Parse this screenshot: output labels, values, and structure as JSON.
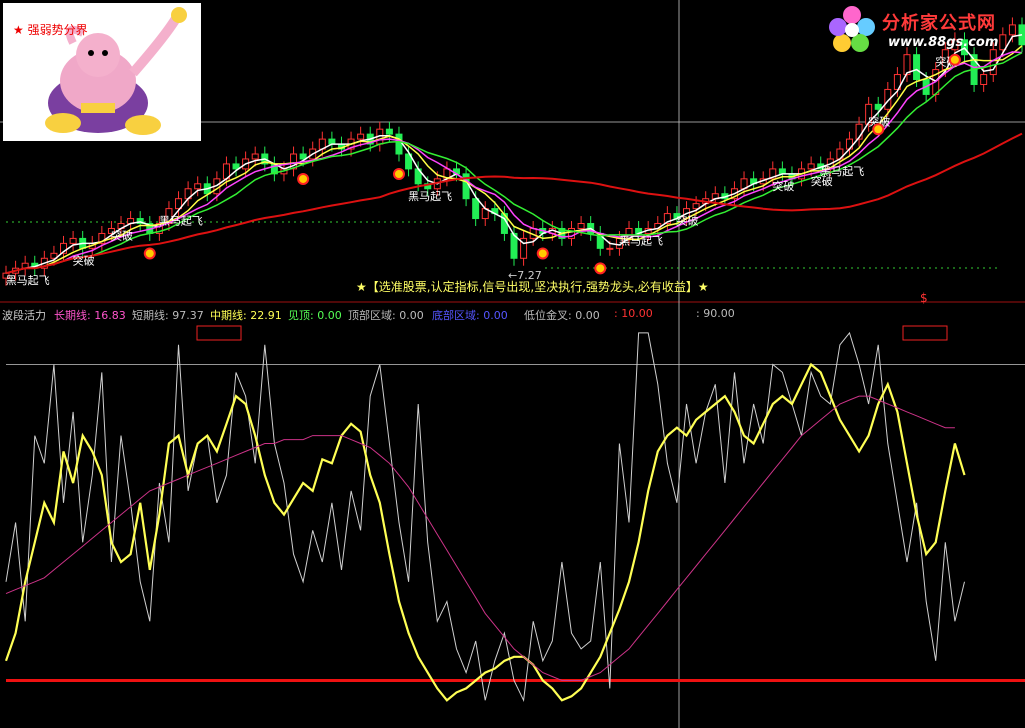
{
  "thumbnail": {
    "title": "★ 强弱势分界"
  },
  "brand": {
    "name": "分析家公式网",
    "url": "www.88gs.com"
  },
  "slogan": "★【选准股票,认定指标,信号出现,坚决执行,强势龙头,必有收益】★",
  "price_panel": {
    "low_marker": "←7.27",
    "dollar_marker": "$",
    "labels": [
      {
        "text": "黑马起飞",
        "i": 1
      },
      {
        "text": "突破",
        "i": 8
      },
      {
        "text": "突破",
        "i": 12
      },
      {
        "text": "黑马起飞",
        "i": 17
      },
      {
        "text": "黑马起飞",
        "i": 43
      },
      {
        "text": "黑马起飞",
        "i": 65
      },
      {
        "text": "突破",
        "i": 71
      },
      {
        "text": "突破",
        "i": 81
      },
      {
        "text": "突破",
        "i": 85
      },
      {
        "text": "黑马起飞",
        "i": 86
      },
      {
        "text": "突破",
        "i": 91
      },
      {
        "text": "突破",
        "i": 98
      }
    ],
    "buy_signals": [
      15,
      31,
      41,
      56,
      62,
      91,
      99
    ]
  },
  "indicator_legend": [
    {
      "key": "name",
      "text": "波段活力",
      "color": "#cccccc"
    },
    {
      "key": "long",
      "text": "长期线: 16.83",
      "color": "#ff55cc"
    },
    {
      "key": "short",
      "text": "短期线: 97.37",
      "color": "#bbbbbb"
    },
    {
      "key": "mid",
      "text": "中期线: 22.91",
      "color": "#ffff55"
    },
    {
      "key": "see",
      "text": "见顶: 0.00",
      "color": "#55ff55"
    },
    {
      "key": "top",
      "text": "顶部区域: 0.00",
      "color": "#bbbbbb"
    },
    {
      "key": "bottom",
      "text": "底部区域: 0.00",
      "color": "#5555ff"
    },
    {
      "key": "gold",
      "text": "低位金叉: 0.00",
      "color": "#bbbbbb"
    },
    {
      "key": "v10",
      "text": ": 10.00",
      "color": "#ff3333"
    },
    {
      "key": "v90",
      "text": ": 90.00",
      "color": "#bbbbbb"
    }
  ],
  "chart_data": [
    {
      "type": "candlestick",
      "close": [
        6.9,
        7.0,
        7.1,
        7.0,
        7.2,
        7.3,
        7.5,
        7.6,
        7.4,
        7.5,
        7.7,
        7.8,
        7.9,
        8.0,
        7.9,
        7.7,
        7.9,
        8.2,
        8.4,
        8.6,
        8.7,
        8.5,
        8.8,
        9.1,
        9.0,
        9.2,
        9.3,
        9.1,
        8.9,
        9.0,
        9.3,
        9.2,
        9.4,
        9.6,
        9.5,
        9.4,
        9.6,
        9.7,
        9.5,
        9.8,
        9.7,
        9.3,
        9.0,
        8.7,
        8.6,
        8.8,
        9.0,
        8.9,
        8.4,
        8.0,
        8.2,
        8.1,
        7.7,
        7.2,
        7.6,
        7.8,
        7.7,
        7.8,
        7.6,
        7.8,
        7.9,
        7.7,
        7.4,
        7.4,
        7.6,
        7.8,
        7.7,
        7.8,
        7.9,
        8.1,
        8.0,
        8.2,
        8.3,
        8.4,
        8.5,
        8.4,
        8.6,
        8.8,
        8.7,
        8.8,
        9.0,
        8.9,
        8.8,
        9.0,
        9.1,
        9.0,
        9.2,
        9.4,
        9.6,
        9.9,
        10.3,
        10.2,
        10.6,
        10.9,
        11.3,
        10.8,
        10.5,
        11.0,
        11.4,
        11.6,
        11.3,
        10.7,
        10.9,
        11.4,
        11.7,
        11.9,
        11.5
      ]
    },
    {
      "type": "line",
      "name_keys": [
        "short",
        "mid",
        "long"
      ],
      "ylim": [
        0,
        100
      ],
      "reference_levels": [
        90,
        10
      ],
      "series": [
        {
          "key": "short",
          "color": "#d0d0d0",
          "values": [
            35,
            50,
            25,
            72,
            65,
            90,
            55,
            78,
            45,
            62,
            88,
            40,
            72,
            55,
            35,
            25,
            60,
            45,
            95,
            58,
            70,
            72,
            55,
            62,
            88,
            82,
            65,
            95,
            70,
            60,
            42,
            35,
            48,
            40,
            55,
            38,
            58,
            48,
            82,
            90,
            70,
            50,
            35,
            80,
            45,
            25,
            30,
            18,
            12,
            20,
            5,
            15,
            22,
            10,
            5,
            25,
            15,
            20,
            40,
            22,
            18,
            20,
            40,
            8,
            70,
            50,
            98,
            98,
            85,
            65,
            55,
            80,
            65,
            78,
            85,
            60,
            88,
            65,
            80,
            70,
            90,
            88,
            80,
            72,
            88,
            82,
            80,
            95,
            98,
            90,
            80,
            95,
            70,
            55,
            40,
            55,
            30,
            15,
            45,
            25,
            35
          ]
        },
        {
          "key": "mid",
          "color": "#ffff55",
          "values": [
            15,
            22,
            35,
            45,
            55,
            50,
            68,
            60,
            72,
            68,
            62,
            45,
            40,
            42,
            55,
            38,
            52,
            70,
            72,
            62,
            70,
            72,
            68,
            75,
            82,
            80,
            72,
            62,
            55,
            52,
            56,
            60,
            58,
            66,
            65,
            72,
            75,
            73,
            62,
            55,
            42,
            30,
            22,
            16,
            12,
            8,
            5,
            7,
            8,
            10,
            12,
            13,
            15,
            16,
            16,
            14,
            10,
            8,
            5,
            6,
            8,
            12,
            16,
            22,
            28,
            35,
            45,
            58,
            68,
            72,
            74,
            72,
            76,
            78,
            80,
            82,
            78,
            72,
            70,
            75,
            80,
            82,
            80,
            85,
            90,
            88,
            82,
            76,
            72,
            68,
            72,
            80,
            85,
            78,
            65,
            52,
            42,
            45,
            58,
            70,
            62
          ]
        },
        {
          "key": "long",
          "color": "#cc3388",
          "values": [
            32,
            33,
            34,
            35,
            36,
            38,
            40,
            42,
            44,
            46,
            48,
            50,
            52,
            54,
            56,
            58,
            59,
            60,
            61,
            62,
            63,
            64,
            65,
            66,
            67,
            68,
            69,
            70,
            70,
            71,
            71,
            71,
            72,
            72,
            72,
            72,
            71,
            70,
            69,
            67,
            65,
            62,
            59,
            55,
            51,
            47,
            43,
            39,
            35,
            31,
            27,
            24,
            21,
            18,
            16,
            14,
            12,
            11,
            10,
            10,
            10,
            11,
            12,
            14,
            16,
            18,
            21,
            24,
            27,
            30,
            33,
            36,
            39,
            42,
            45,
            48,
            51,
            54,
            57,
            60,
            63,
            66,
            69,
            72,
            74,
            76,
            78,
            80,
            81,
            82,
            82,
            81,
            80,
            79,
            78,
            77,
            76,
            75,
            74,
            74
          ]
        }
      ]
    }
  ]
}
